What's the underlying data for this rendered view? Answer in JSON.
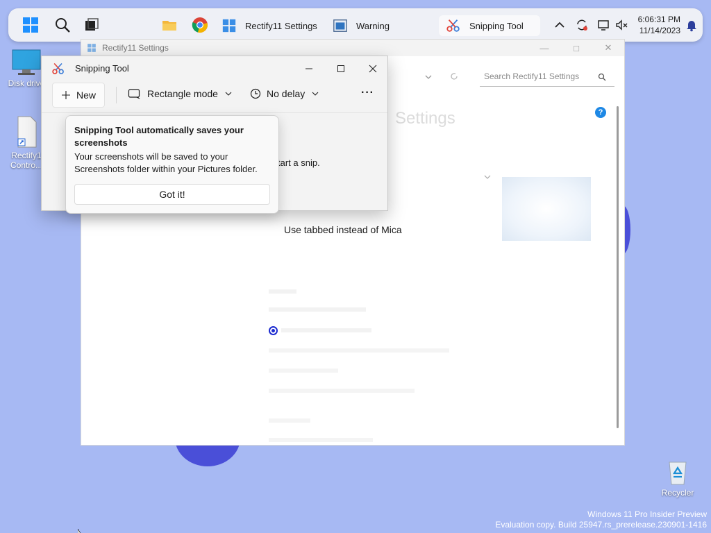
{
  "taskbar": {
    "apps": [
      {
        "label": "Rectify11 Settings",
        "icon": "settings-app-icon"
      },
      {
        "label": "Warning",
        "icon": "warning-window-icon"
      },
      {
        "label": "Snipping Tool",
        "icon": "scissors-icon"
      }
    ],
    "clock": {
      "time": "6:06:31 PM",
      "date": "11/14/2023"
    }
  },
  "desktop": {
    "icons": [
      {
        "label": "Disk drive"
      },
      {
        "label": "Rectify1 Contro..."
      }
    ],
    "recycle_label": "Recycler",
    "watermark": {
      "line1": "Windows 11 Pro Insider Preview",
      "line2": "Evaluation copy. Build 25947.rs_prerelease.230901-1416"
    }
  },
  "rectify_window": {
    "title": "Rectify11 Settings",
    "search_placeholder": "Search Rectify11 Settings",
    "heading": "Settings",
    "option_label": "Use tabbed instead of Mica",
    "help": "?"
  },
  "snipping_tool": {
    "title": "Snipping Tool",
    "new_label": "New",
    "mode_label": "Rectangle mode",
    "delay_label": "No delay",
    "more_label": "···",
    "body_text": "tart a snip.",
    "teaching_tip": {
      "title": "Snipping Tool automatically saves your screenshots",
      "body": "Your screenshots will be saved to your Screenshots folder within your Pictures folder.",
      "button": "Got it!"
    }
  },
  "colors": {
    "accent": "#2c6bd6",
    "desktop": "#a7b9f3",
    "blob": "#4a4fd8"
  }
}
